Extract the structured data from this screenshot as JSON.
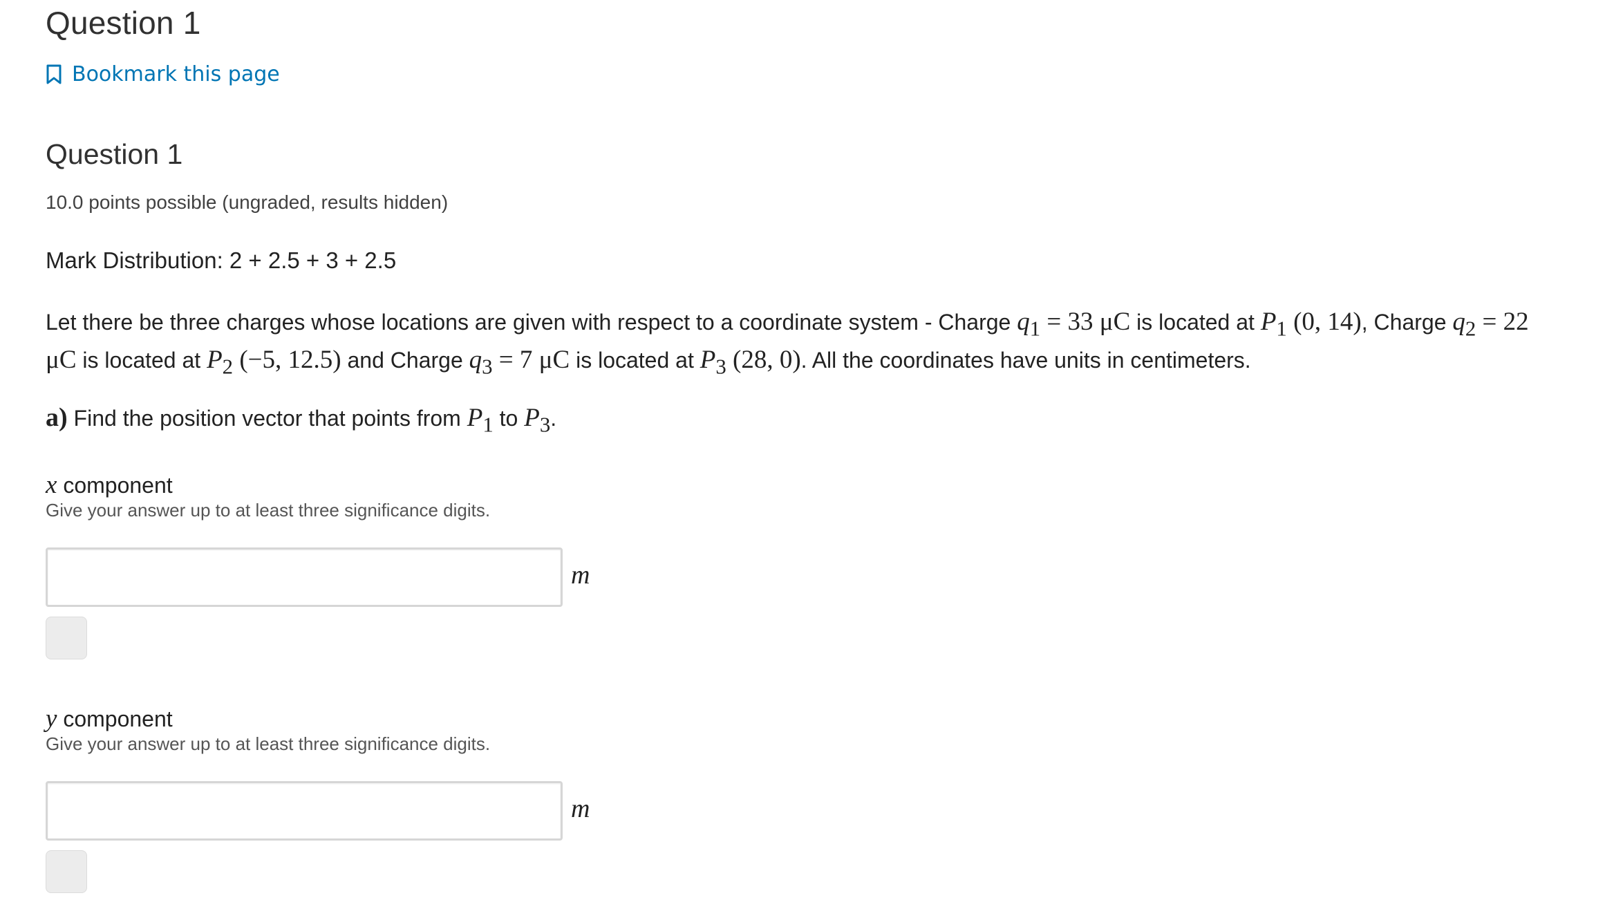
{
  "unit": {
    "title": "Question 1",
    "bookmark_label": "Bookmark this page"
  },
  "problem": {
    "title": "Question 1",
    "points": "10.0 points possible (ungraded, results hidden)",
    "mark_distribution": "Mark Distribution: 2 + 2.5 + 3 + 2.5",
    "statement": {
      "t1": "Let there be three charges whose locations are given with respect to a coordinate system - Charge ",
      "q1": "q",
      "q1_sub": "1",
      "q1_val": " = 33 μC",
      "t2": " is located at ",
      "p1": "P",
      "p1_sub": "1",
      "p1_coord": " (0, 14)",
      "t3": ", Charge ",
      "q2": "q",
      "q2_sub": "2",
      "q2_val": " = 22 μC",
      "t4": " is located at ",
      "p2": "P",
      "p2_sub": "2",
      "p2_coord": " (−5, 12.5)",
      "t5": " and Charge ",
      "q3": "q",
      "q3_sub": "3",
      "q3_val": " = 7 μC",
      "t6": " is located at ",
      "p3": "P",
      "p3_sub": "3",
      "p3_coord": " (28, 0)",
      "t7": ". All the coordinates have units in centimeters."
    },
    "part_a": {
      "label": "a)",
      "text": " Find the position vector that points from ",
      "from": "P",
      "from_sub": "1",
      "mid": " to ",
      "to": "P",
      "to_sub": "3",
      "end": "."
    },
    "components": [
      {
        "var": "x",
        "label": " component",
        "hint": "Give your answer up to at least three significance digits.",
        "value": "",
        "unit": "m"
      },
      {
        "var": "y",
        "label": " component",
        "hint": "Give your answer up to at least three significance digits.",
        "value": "",
        "unit": "m"
      }
    ]
  },
  "colors": {
    "link": "#0075b4",
    "heading": "#313131",
    "text": "#222222",
    "input_border": "#d6d6d6",
    "button_bg": "#ececec"
  }
}
